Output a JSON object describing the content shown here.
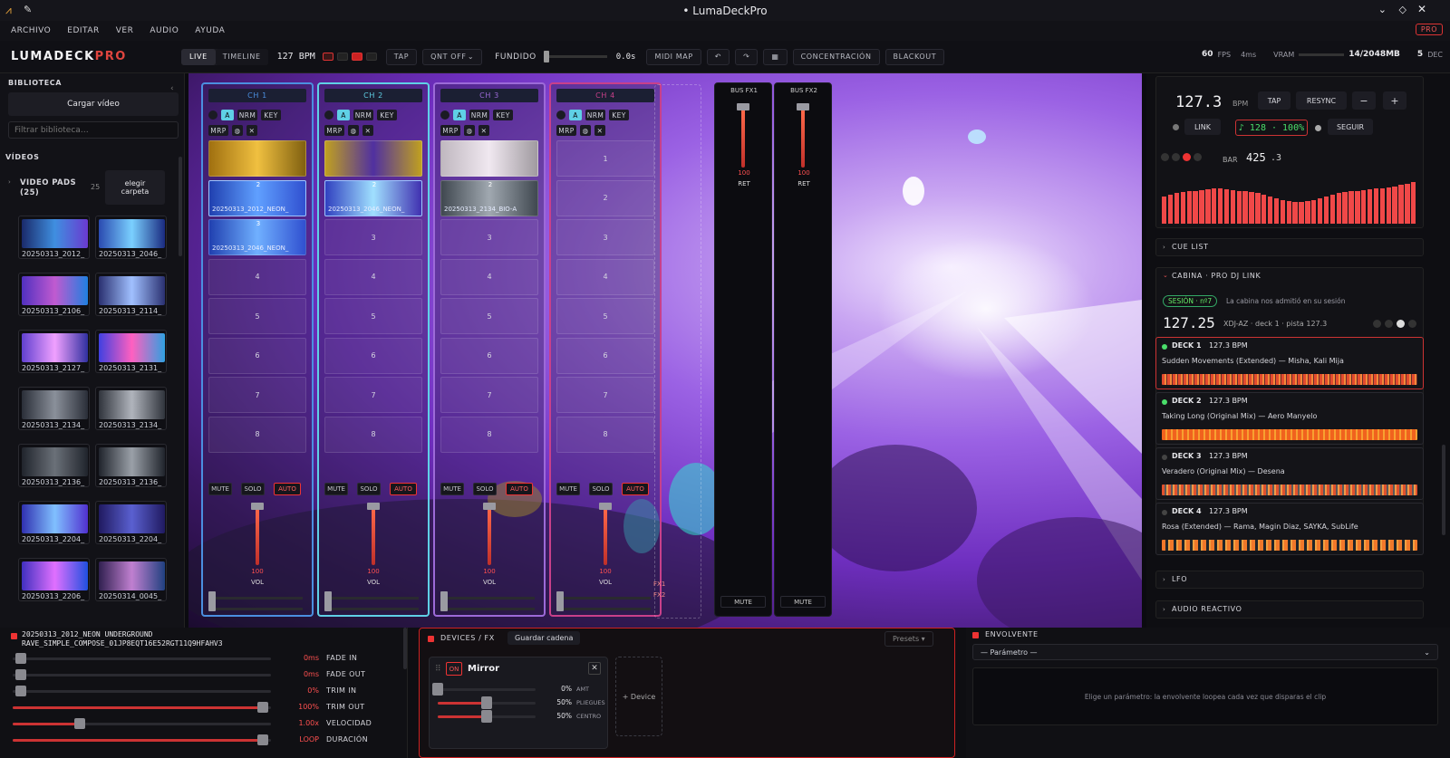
{
  "window": {
    "title": "• LumaDeckPro"
  },
  "menu": [
    "ARCHIVO",
    "EDITAR",
    "VER",
    "AUDIO",
    "AYUDA"
  ],
  "pro_badge": "PRO",
  "toolbar": {
    "logo_main": "LUMADECK",
    "logo_accent": "PRO",
    "mode_live": "LIVE",
    "mode_timeline": "TIMELINE",
    "bpm": "127 BPM",
    "tap": "TAP",
    "quant": "QNT OFF",
    "fade_label": "FUNDIDO",
    "fade_value": "0.0s",
    "midi_map": "MIDI MAP",
    "focus": "CONCENTRACIÓN",
    "blackout": "BLACKOUT",
    "fps_value": "60",
    "fps_unit": "FPS",
    "ms": "4ms",
    "vram_label": "VRAM",
    "vram_value": "14/2048MB",
    "dec_value": "5",
    "dec_unit": "DEC"
  },
  "library": {
    "title": "BIBLIOTECA",
    "load_button": "Cargar vídeo",
    "filter_placeholder": "Filtrar biblioteca…",
    "videos_label": "VÍDEOS",
    "pads_label": "VIDEO PADS",
    "pads_count_label": "(25)",
    "pads_count": "25",
    "choose_folder": "elegir carpeta",
    "thumbs": [
      "20250313_2012_",
      "20250313_2046_",
      "20250313_2106_",
      "20250313_2114_",
      "20250313_2127_",
      "20250313_2131_",
      "20250313_2134_",
      "20250313_2134_",
      "20250313_2136_",
      "20250313_2136_",
      "20250313_2204_",
      "20250313_2204_",
      "20250313_2206_",
      "20250314_0045_"
    ]
  },
  "channels": [
    {
      "name": "CH 1",
      "clip_label": "20250313_2012_NEON_"
    },
    {
      "name": "CH 2",
      "clip_label": "20250313_2046_NEON_"
    },
    {
      "name": "CH 3",
      "clip_label": "20250313_2134_BIO-A"
    },
    {
      "name": "CH 4",
      "clip_label": ""
    }
  ],
  "channel_controls": {
    "a": "A",
    "nrm": "NRM",
    "key": "KEY",
    "mrp": "MRP",
    "mute": "MUTE",
    "solo": "SOLO",
    "auto": "AUTO",
    "vol": "VOL",
    "vol_value": "100"
  },
  "slots": [
    "1",
    "2",
    "3",
    "4",
    "5",
    "6",
    "7",
    "8"
  ],
  "ch1_third_label": "20250313_2046_NEON_",
  "fx_labels": {
    "fx1": "FX1",
    "fx2": "FX2"
  },
  "buses": [
    {
      "name": "BUS FX1",
      "value": "100",
      "ret": "RET",
      "mute": "MUTE"
    },
    {
      "name": "BUS FX2",
      "value": "100",
      "ret": "RET",
      "mute": "MUTE"
    }
  ],
  "tempo": {
    "bpm": "127.3",
    "bpm_unit": "BPM",
    "tap": "TAP",
    "resync": "RESYNC",
    "minus": "−",
    "plus": "+",
    "link": "LINK",
    "link_value": "♪ 128 · 100%",
    "follow": "SEGUIR",
    "bar_label": "BAR",
    "bar_value": "425",
    "beat_value": ".3",
    "meter_levels": [
      0.62,
      0.66,
      0.7,
      0.72,
      0.74,
      0.76,
      0.78,
      0.8,
      0.82,
      0.82,
      0.8,
      0.78,
      0.76,
      0.74,
      0.72,
      0.7,
      0.66,
      0.62,
      0.58,
      0.55,
      0.52,
      0.5,
      0.5,
      0.52,
      0.55,
      0.58,
      0.62,
      0.66,
      0.7,
      0.72,
      0.74,
      0.76,
      0.78,
      0.8,
      0.82,
      0.82,
      0.84,
      0.86,
      0.9,
      0.92,
      0.95
    ]
  },
  "sections": {
    "cue_list": "CUE LIST",
    "cabina": "CABINA · PRO DJ LINK",
    "lfo": "LFO",
    "audio_reactivo": "AUDIO REACTIVO"
  },
  "cabina": {
    "session_badge": "SESIÓN · nº7",
    "session_msg": "La cabina nos admitió en su sesión",
    "bpm": "127.25",
    "info": "XDJ-AZ · deck 1 · pista 127.3"
  },
  "decks": [
    {
      "name": "DECK 1",
      "bpm": "127.3 BPM",
      "track": "Sudden Movements (Extended) — Misha, Kali Mija",
      "active": true
    },
    {
      "name": "DECK 2",
      "bpm": "127.3 BPM",
      "track": "Taking Long (Original Mix) — Aero Manyelo",
      "active": true
    },
    {
      "name": "DECK 3",
      "bpm": "127.3 BPM",
      "track": "Veradero (Original Mix) — Desena",
      "active": false
    },
    {
      "name": "DECK 4",
      "bpm": "127.3 BPM",
      "track": "Rosa (Extended) — Rama, Magin Diaz, SAYKA, SubLife",
      "active": false
    }
  ],
  "clip": {
    "title_line1": "20250313_2012_NEON UNDERGROUND",
    "title_line2": "RAVE_SIMPLE_COMPOSE_01JP8EQT16E52RGT11Q9HFAHV3",
    "params": [
      {
        "value": "0ms",
        "label": "FADE IN",
        "level": 0.03
      },
      {
        "value": "0ms",
        "label": "FADE OUT",
        "level": 0.03
      },
      {
        "value": "0%",
        "label": "TRIM IN",
        "level": 0.03
      },
      {
        "value": "100%",
        "label": "TRIM OUT",
        "level": 0.97
      },
      {
        "value": "1.00x",
        "label": "VELOCIDAD",
        "level": 0.26
      },
      {
        "value": "LOOP",
        "label": "DURACIÓN",
        "level": 0.97
      }
    ]
  },
  "devices": {
    "title": "DEVICES / FX",
    "save_chain": "Guardar cadena",
    "presets": "Presets ▾",
    "device_on": "ON",
    "device_name": "Mirror",
    "add_device": "+ Device",
    "params": [
      {
        "value": "0%",
        "label": "AMT",
        "level": 0.0
      },
      {
        "value": "50%",
        "label": "PLIEGUES",
        "level": 0.5
      },
      {
        "value": "50%",
        "label": "CENTRO",
        "level": 0.5
      }
    ]
  },
  "envelope": {
    "title": "ENVOLVENTE",
    "select": "— Parámetro —",
    "hint": "Elige un parámetro: la envolvente loopea cada vez que disparas el clip"
  },
  "colors": {
    "accent": "#e53b3b",
    "ch1": "#4b8fe0",
    "ch2": "#5fd0e6",
    "ch3": "#9c6ad8",
    "ch4": "#c8408a"
  }
}
